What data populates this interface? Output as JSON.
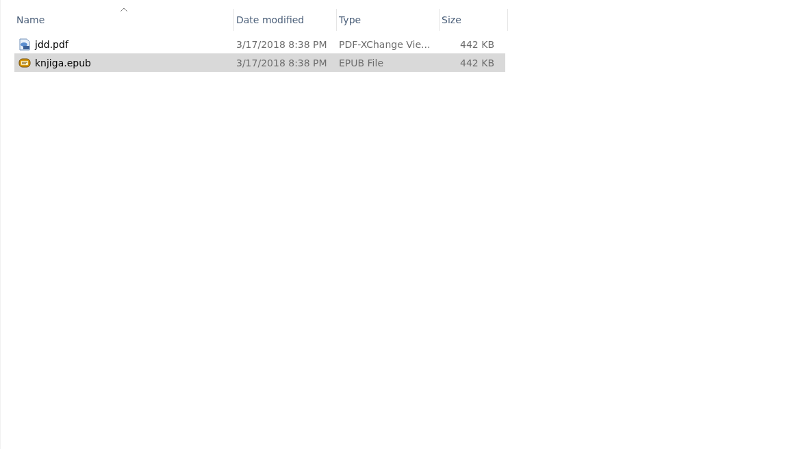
{
  "columns": [
    {
      "label": "Name",
      "sorted": true
    },
    {
      "label": "Date modified",
      "sorted": false
    },
    {
      "label": "Type",
      "sorted": false
    },
    {
      "label": "Size",
      "sorted": false
    }
  ],
  "rows": [
    {
      "kind": "pdf",
      "name": "jdd.pdf",
      "date": "3/17/2018 8:38 PM",
      "type": "PDF-XChange Vie...",
      "size": "442 KB",
      "selected": false
    },
    {
      "kind": "epub",
      "name": "knjiga.epub",
      "date": "3/17/2018 8:38 PM",
      "type": "EPUB File",
      "size": "442 KB",
      "selected": true
    }
  ]
}
